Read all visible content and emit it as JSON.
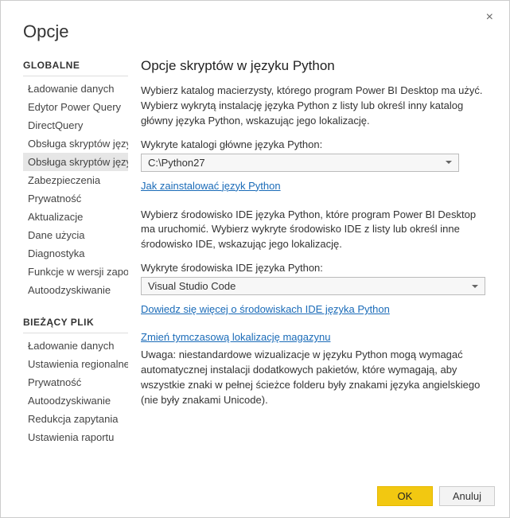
{
  "dialog": {
    "title": "Opcje",
    "close_label": "×"
  },
  "sidebar": {
    "global_header": "GLOBALNE",
    "global_items": [
      "Ładowanie danych",
      "Edytor Power Query",
      "DirectQuery",
      "Obsługa skryptów języka R",
      "Obsługa skryptów języka Python",
      "Zabezpieczenia",
      "Prywatność",
      "Aktualizacje",
      "Dane użycia",
      "Diagnostyka",
      "Funkcje w wersji zapoznawczej",
      "Autoodzyskiwanie"
    ],
    "global_selected_index": 4,
    "file_header": "BIEŻĄCY PLIK",
    "file_items": [
      "Ładowanie danych",
      "Ustawienia regionalne",
      "Prywatność",
      "Autoodzyskiwanie",
      "Redukcja zapytania",
      "Ustawienia raportu"
    ]
  },
  "main": {
    "heading": "Opcje skryptów w języku Python",
    "intro": "Wybierz katalog macierzysty, którego program Power BI Desktop ma użyć. Wybierz wykrytą instalację języka Python z listy lub określ inny katalog główny języka Python, wskazując jego lokalizację.",
    "home_label": "Wykryte katalogi główne języka Python:",
    "home_value": "C:\\Python27",
    "install_link": "Jak zainstalować język Python",
    "ide_intro": "Wybierz środowisko IDE języka Python, które program Power BI Desktop ma uruchomić. Wybierz wykryte środowisko IDE z listy lub określ inne środowisko IDE, wskazując jego lokalizację.",
    "ide_label": "Wykryte środowiska IDE języka Python:",
    "ide_value": "Visual Studio Code",
    "ide_link": "Dowiedz się więcej o środowiskach IDE języka Python",
    "temp_link": "Zmień tymczasową lokalizację magazynu",
    "warning": "Uwaga: niestandardowe wizualizacje w języku Python mogą wymagać automatycznej instalacji dodatkowych pakietów, które wymagają, aby wszystkie znaki w pełnej ścieżce folderu były znakami języka angielskiego (nie były znakami Unicode)."
  },
  "footer": {
    "ok": "OK",
    "cancel": "Anuluj"
  }
}
